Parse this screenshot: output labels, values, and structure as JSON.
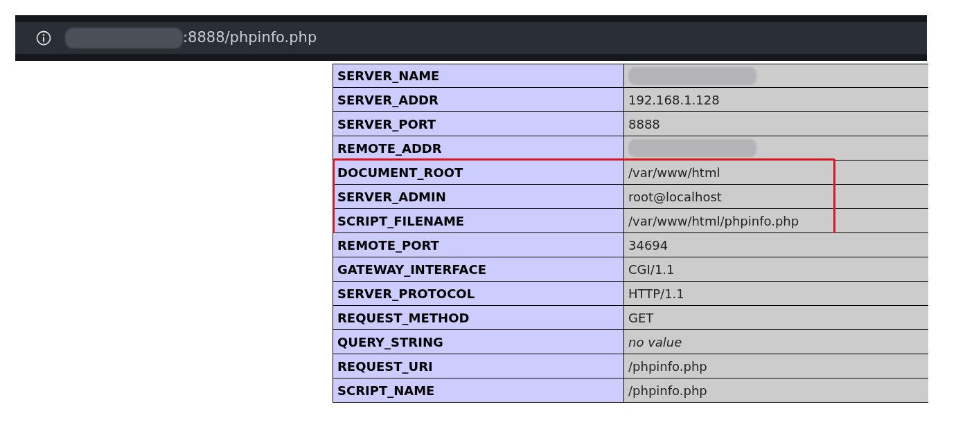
{
  "address_bar": {
    "host_redacted": true,
    "url": ":8888/phpinfo.php"
  },
  "table": {
    "sections": [
      {
        "highlighted": false,
        "rows": [
          {
            "name": "SERVER_NAME",
            "kind": "redacted"
          },
          {
            "name": "SERVER_ADDR",
            "value": "192.168.1.128",
            "kind": "text"
          },
          {
            "name": "SERVER_PORT",
            "value": "8888",
            "kind": "text"
          },
          {
            "name": "REMOTE_ADDR",
            "kind": "redacted"
          }
        ]
      },
      {
        "highlighted": true,
        "rows": [
          {
            "name": "DOCUMENT_ROOT",
            "value": "/var/www/html",
            "kind": "text"
          },
          {
            "name": "SERVER_ADMIN",
            "value": "root@localhost",
            "kind": "text"
          },
          {
            "name": "SCRIPT_FILENAME",
            "value": "/var/www/html/phpinfo.php",
            "kind": "text"
          }
        ]
      },
      {
        "highlighted": false,
        "rows": [
          {
            "name": "REMOTE_PORT",
            "value": "34694",
            "kind": "text"
          },
          {
            "name": "GATEWAY_INTERFACE",
            "value": "CGI/1.1",
            "kind": "text"
          },
          {
            "name": "SERVER_PROTOCOL",
            "value": "HTTP/1.1",
            "kind": "text"
          },
          {
            "name": "REQUEST_METHOD",
            "value": "GET",
            "kind": "text"
          },
          {
            "name": "QUERY_STRING",
            "value": "no value",
            "kind": "no-value"
          },
          {
            "name": "REQUEST_URI",
            "value": "/phpinfo.php",
            "kind": "text"
          },
          {
            "name": "SCRIPT_NAME",
            "value": "/phpinfo.php",
            "kind": "text"
          }
        ]
      }
    ]
  }
}
